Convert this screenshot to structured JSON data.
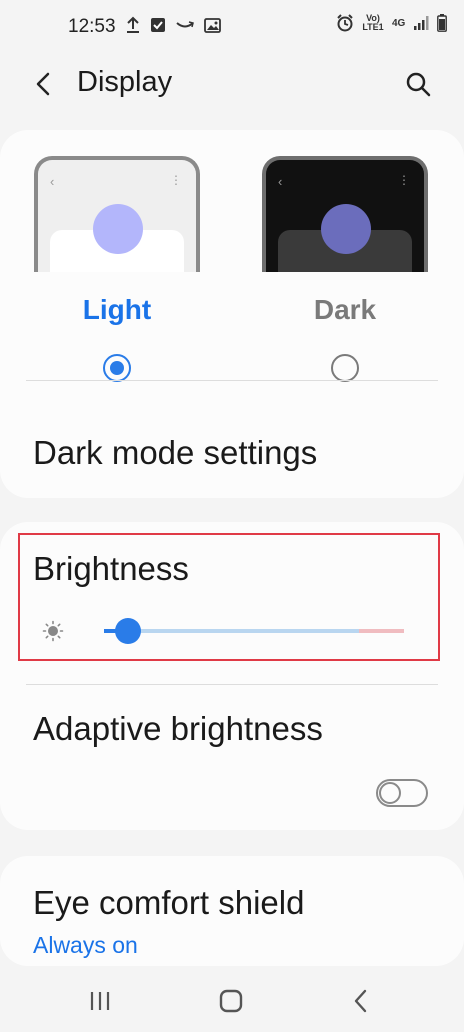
{
  "status": {
    "time": "12:53",
    "left_icons": [
      "upload-icon",
      "check-box-icon",
      "amazon-icon",
      "image-icon"
    ],
    "right_icons": [
      "alarm-icon",
      "volte-icon",
      "4g-icon",
      "signal-icon",
      "battery-icon"
    ],
    "volte_text": "Vo) LTE1",
    "network_text": "4G"
  },
  "header": {
    "title": "Display"
  },
  "theme": {
    "light_label": "Light",
    "dark_label": "Dark",
    "selected": "Light"
  },
  "settings": {
    "dark_mode_settings": "Dark mode settings",
    "brightness": "Brightness",
    "brightness_level": 0.06,
    "adaptive_brightness": "Adaptive brightness",
    "adaptive_brightness_on": false,
    "eye_comfort_shield": "Eye comfort shield",
    "eye_comfort_value": "Always on"
  },
  "colors": {
    "accent": "#2a7ce8",
    "highlight_box": "#e03a46"
  }
}
